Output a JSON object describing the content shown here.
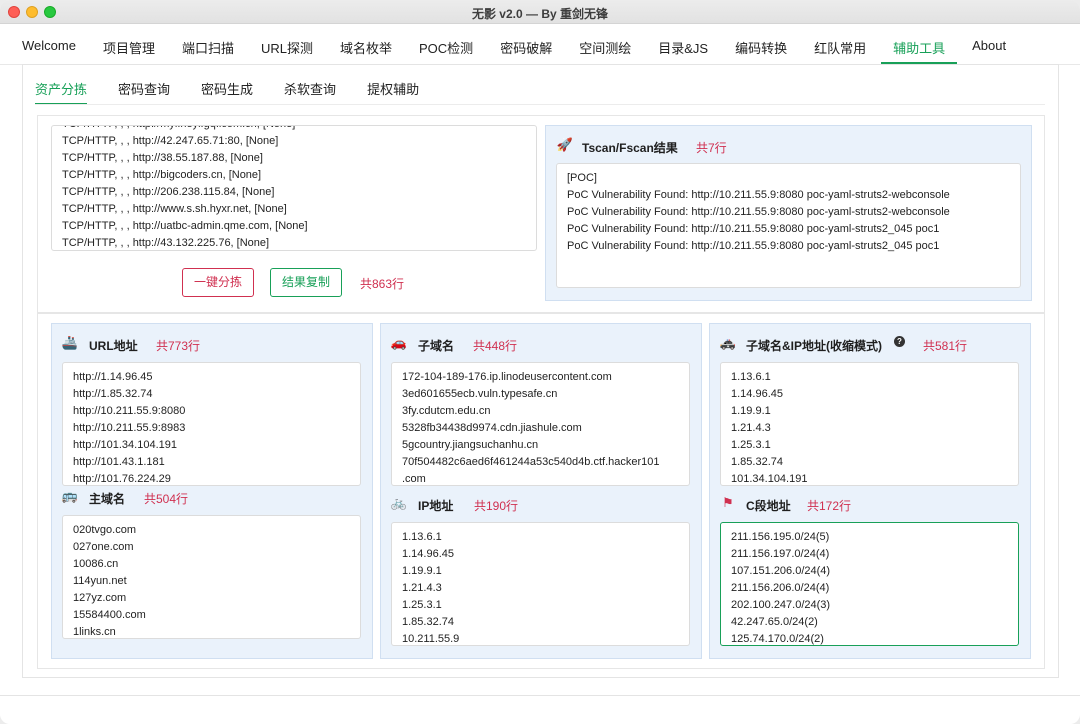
{
  "window": {
    "title": "无影 v2.0 — By 重剑无锋"
  },
  "main_tabs": [
    {
      "label": "Welcome"
    },
    {
      "label": "项目管理"
    },
    {
      "label": "端口扫描"
    },
    {
      "label": "URL探测"
    },
    {
      "label": "域名枚举"
    },
    {
      "label": "POC检测"
    },
    {
      "label": "密码破解"
    },
    {
      "label": "空间测绘"
    },
    {
      "label": "目录&JS"
    },
    {
      "label": "编码转换"
    },
    {
      "label": "红队常用"
    },
    {
      "label": "辅助工具"
    },
    {
      "label": "About"
    }
  ],
  "active_main_tab": "辅助工具",
  "sub_tabs": [
    {
      "label": "资产分拣"
    },
    {
      "label": "密码查询"
    },
    {
      "label": "密码生成"
    },
    {
      "label": "杀软查询"
    },
    {
      "label": "提权辅助"
    }
  ],
  "active_sub_tab": "资产分拣",
  "input_box": {
    "lines": [
      "TCP/HTTP, , , http://myl.heyi.gq.icom.cn, [None]",
      "TCP/HTTP, , , http://42.247.65.71:80, [None]",
      "TCP/HTTP, , , http://38.55.187.88, [None]",
      "TCP/HTTP, , , http://bigcoders.cn, [None]",
      "TCP/HTTP, , , http://206.238.115.84, [None]",
      "TCP/HTTP, , , http://www.s.sh.hyxr.net, [None]",
      "TCP/HTTP, , , http://uatbc-admin.qme.com, [None]",
      "TCP/HTTP, , , http://43.132.225.76, [None]"
    ]
  },
  "buttons": {
    "sort": "一键分拣",
    "copy": "结果复制"
  },
  "total_count": "共863行",
  "tscan": {
    "icon": "rocket-icon",
    "title": "Tscan/Fscan结果",
    "count": "共7行",
    "lines": [
      "[POC]",
      "PoC Vulnerability Found: http://10.211.55.9:8080 poc-yaml-struts2-webconsole",
      "PoC Vulnerability Found: http://10.211.55.9:8080 poc-yaml-struts2-webconsole",
      "PoC Vulnerability Found: http://10.211.55.9:8080 poc-yaml-struts2_045 poc1",
      "PoC Vulnerability Found: http://10.211.55.9:8080 poc-yaml-struts2_045 poc1"
    ]
  },
  "url_panel": {
    "icon": "ship-icon",
    "title": "URL地址",
    "count": "共773行",
    "lines": [
      "http://1.14.96.45",
      "http://1.85.32.74",
      "http://10.211.55.9:8080",
      "http://10.211.55.9:8983",
      "http://101.34.104.191",
      "http://101.43.1.181",
      "http://101.76.224.29"
    ]
  },
  "main_domain_panel": {
    "icon": "bus-icon",
    "title": "主域名",
    "count": "共504行",
    "lines": [
      "020tvgo.com",
      "027one.com",
      "10086.cn",
      "114yun.net",
      "127yz.com",
      "15584400.com",
      "1links.cn"
    ]
  },
  "subdomain_panel": {
    "icon": "car-icon",
    "title": "子域名",
    "count": "共448行",
    "lines": [
      "172-104-189-176.ip.linodeusercontent.com",
      "3ed601655ecb.vuln.typesafe.cn",
      "3fy.cdutcm.edu.cn",
      "5328fb34438d9974.cdn.jiashule.com",
      "5gcountry.jiangsuchanhu.cn",
      "70f504482c6aed6f461244a53c540d4b.ctf.hacker101",
      ".com"
    ]
  },
  "ip_panel": {
    "icon": "bicycle-icon",
    "title": "IP地址",
    "count": "共190行",
    "lines": [
      "1.13.6.1",
      "1.14.96.45",
      "1.19.9.1",
      "1.21.4.3",
      "1.25.3.1",
      "1.85.32.74",
      "10.211.55.9"
    ]
  },
  "subdomain_ip_panel": {
    "icon": "police-car-icon",
    "title": "子域名&IP地址(收缩模式)",
    "help": "?",
    "count": "共581行",
    "lines": [
      "1.13.6.1",
      "1.14.96.45",
      "1.19.9.1",
      "1.21.4.3",
      "1.25.3.1",
      "1.85.32.74",
      "101.34.104.191"
    ]
  },
  "c_segment_panel": {
    "icon": "flag-icon",
    "title": "C段地址",
    "count": "共172行",
    "lines": [
      "211.156.195.0/24(5)",
      "211.156.197.0/24(4)",
      "107.151.206.0/24(4)",
      "211.156.206.0/24(4)",
      "202.100.247.0/24(3)",
      "42.247.65.0/24(2)",
      "125.74.170.0/24(2)"
    ]
  }
}
